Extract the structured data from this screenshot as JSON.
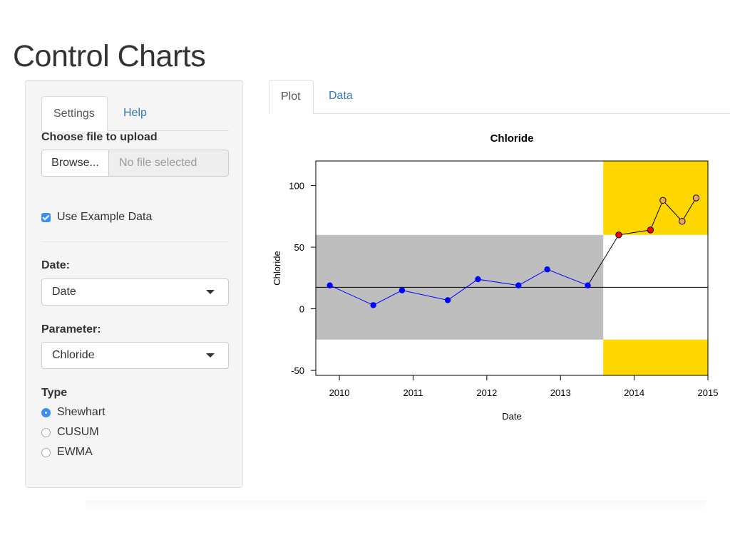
{
  "page": {
    "title": "Control Charts"
  },
  "sidebar": {
    "tabs": [
      {
        "label": "Settings",
        "active": true
      },
      {
        "label": "Help",
        "active": false
      }
    ],
    "file_upload": {
      "label": "Choose file to upload",
      "button_label": "Browse...",
      "placeholder": "No file selected"
    },
    "example_data": {
      "label": "Use Example Data",
      "checked": true
    },
    "date": {
      "label": "Date:",
      "value": "Date"
    },
    "parameter": {
      "label": "Parameter:",
      "value": "Chloride"
    },
    "type": {
      "label": "Type",
      "options": [
        {
          "label": "Shewhart",
          "selected": true
        },
        {
          "label": "CUSUM",
          "selected": false
        },
        {
          "label": "EWMA",
          "selected": false
        }
      ]
    }
  },
  "main": {
    "tabs": [
      {
        "label": "Plot",
        "active": true
      },
      {
        "label": "Data",
        "active": false
      }
    ]
  },
  "colors": {
    "link": "#337ab7",
    "accent": "#3a8ef6",
    "baseline_band": "#bebebe",
    "out_of_control_band": "#ffd700",
    "baseline_points": "#0000ff",
    "flagged_point": "#ff0000",
    "warning_point": "#f4a460"
  },
  "chart_data": {
    "type": "line",
    "title": "Chloride",
    "xlabel": "Date",
    "ylabel": "Chloride",
    "xlim": [
      2009.68,
      2015.0
    ],
    "ylim": [
      -54,
      120
    ],
    "x_ticks": [
      2010,
      2011,
      2012,
      2013,
      2014,
      2015
    ],
    "y_ticks": [
      -50,
      0,
      50,
      100
    ],
    "center_line": 17.5,
    "control_limits": [
      -25,
      60
    ],
    "baseline_end": 2013.58,
    "grid": false,
    "series": [
      {
        "x": [
          2009.87,
          2010.46,
          2010.85,
          2011.47,
          2011.88,
          2012.43,
          2012.82,
          2013.37
        ],
        "y": [
          19,
          3,
          15,
          7,
          24,
          19,
          32,
          19
        ],
        "color": "#0000ff"
      },
      {
        "x": [
          2013.37,
          2013.79,
          2014.22,
          2014.39,
          2014.65,
          2014.84
        ],
        "y": [
          19,
          60,
          64,
          88,
          71,
          90
        ],
        "point_colors": [
          "#0000ff",
          "#ff0000",
          "#ff0000",
          "#f4a460",
          "#f4a460",
          "#f4a460"
        ]
      }
    ]
  }
}
